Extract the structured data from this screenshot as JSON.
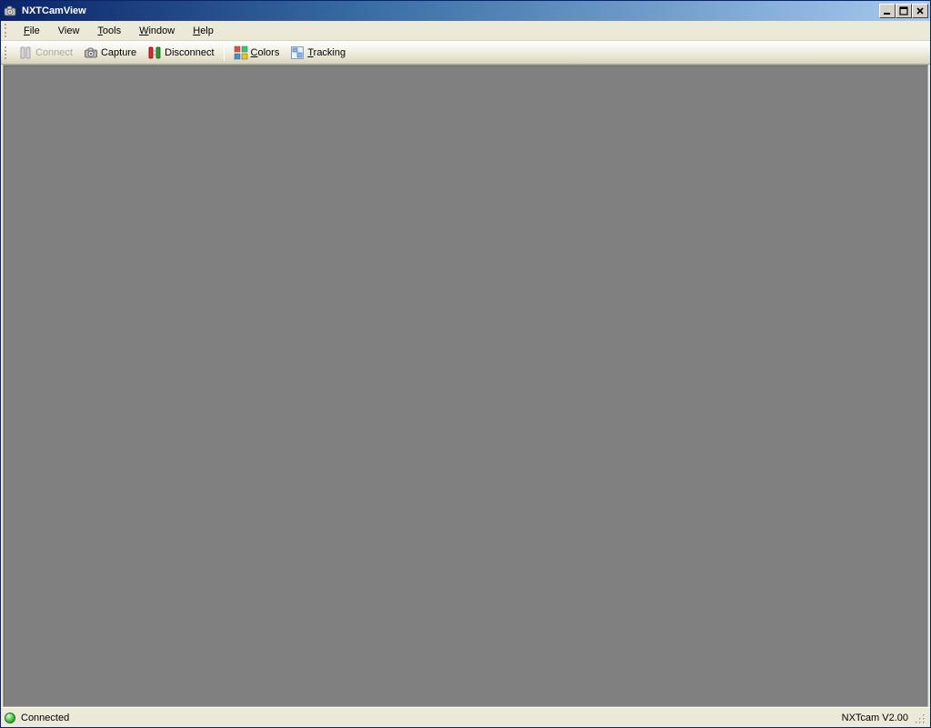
{
  "window": {
    "title": "NXTCamView"
  },
  "menu": {
    "file": "File",
    "view": "View",
    "tools": "Tools",
    "window": "Window",
    "help": "Help",
    "file_accel": "F",
    "tools_accel": "T",
    "window_accel": "W",
    "help_accel": "H"
  },
  "toolbar": {
    "connect": "Connect",
    "capture": "Capture",
    "disconnect": "Disconnect",
    "colors": "Colors",
    "tracking": "Tracking"
  },
  "status": {
    "connection": "Connected",
    "version": "NXTcam V2.00"
  }
}
